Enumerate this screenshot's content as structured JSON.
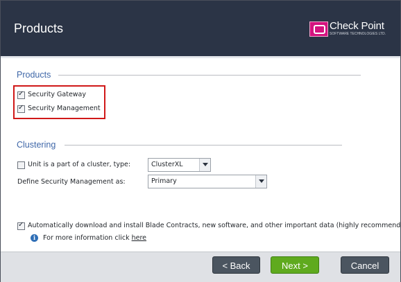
{
  "header": {
    "title": "Products",
    "logo": {
      "name": "Check Point",
      "tagline": "SOFTWARE TECHNOLOGIES LTD."
    }
  },
  "products_section": {
    "title": "Products",
    "items": [
      {
        "label": "Security Gateway",
        "checked": true
      },
      {
        "label": "Security Management",
        "checked": true
      }
    ]
  },
  "clustering_section": {
    "title": "Clustering",
    "cluster_checkbox": {
      "label": "Unit is a part of a cluster, type:",
      "checked": false
    },
    "cluster_type": "ClusterXL",
    "management_label": "Define Security Management as:",
    "management_value": "Primary"
  },
  "auto_download": {
    "label": "Automatically download and install Blade Contracts, new software, and other important data (highly recommended)",
    "checked": true,
    "info_text": "For more information click",
    "link_text": "here"
  },
  "footer": {
    "back_label": "< Back",
    "next_label": "Next >",
    "cancel_label": "Cancel"
  },
  "colors": {
    "header_bg": "#2b3446",
    "section_title": "#3f67a8",
    "highlight_border": "#d01818",
    "next_button": "#5faa1e",
    "dark_button": "#4b5560"
  }
}
